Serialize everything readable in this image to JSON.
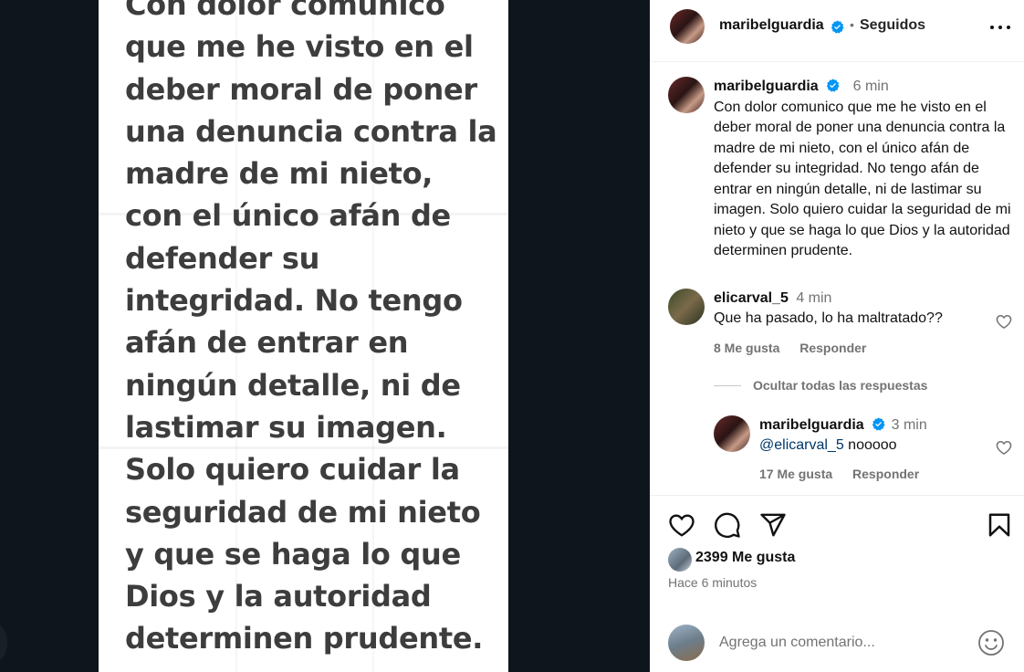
{
  "image_text": "Con dolor comunico que me he visto en el deber moral de poner una denuncia contra la madre de mi nieto, con el único afán de defender su integridad.  No tengo afán de entrar en ningún detalle, ni de lastimar su imagen. Solo quiero cuidar la seguridad de mi nieto y que se haga lo que Dios y la autoridad determinen prudente.",
  "header": {
    "username": "maribelguardia",
    "separator": "•",
    "follow_status": "Seguidos"
  },
  "caption": {
    "username": "maribelguardia",
    "time": "6 min",
    "text": "Con dolor comunico que me he visto en el deber moral de poner una denuncia contra la madre de mi nieto, con el único afán de defender su integridad. No tengo afán de entrar en ningún detalle, ni de lastimar su imagen. Solo quiero cuidar la seguridad de mi nieto y que se haga lo que Dios y la autoridad determinen prudente."
  },
  "comments": [
    {
      "username": "elicarval_5",
      "time": "4 min",
      "text": "Que ha pasado, lo ha maltratado??",
      "likes": "8 Me gusta",
      "reply_label": "Responder"
    }
  ],
  "hide_replies_label": "Ocultar todas las respuestas",
  "reply": {
    "username": "maribelguardia",
    "time": "3 min",
    "mention": "@elicarval_5",
    "text": " nooooo",
    "likes": "17 Me gusta",
    "reply_label": "Responder"
  },
  "likes_label": "2399 Me gusta",
  "post_time": "Hace 6 minutos",
  "comment_input": {
    "placeholder": "Agrega un comentario..."
  },
  "icons": {
    "verified": "verified-badge-icon",
    "more": "more-options-icon",
    "like": "heart-icon",
    "comment": "comment-bubble-icon",
    "share": "paper-plane-icon",
    "save": "bookmark-icon",
    "emoji": "emoji-icon"
  },
  "colors": {
    "verified_blue": "#0095f6",
    "secondary_text": "#737373",
    "mention": "#00376b",
    "media_background": "#0f151c"
  }
}
